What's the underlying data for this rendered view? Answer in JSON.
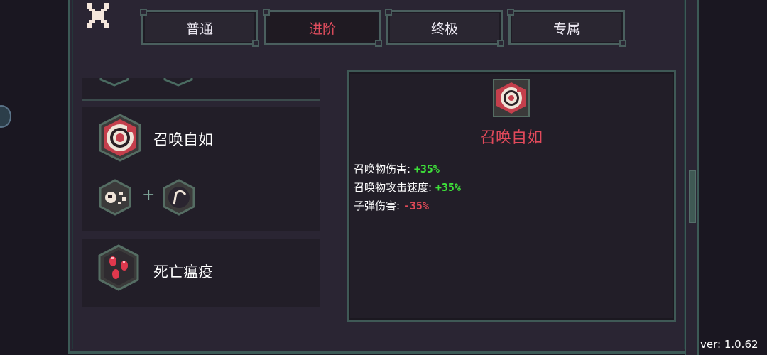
{
  "tabs": [
    {
      "label": "普通",
      "active": false
    },
    {
      "label": "进阶",
      "active": true
    },
    {
      "label": "终极",
      "active": false
    },
    {
      "label": "专属",
      "active": false
    }
  ],
  "skill_list": [
    {
      "name": "召唤自如",
      "icon": "summon-swirl-icon",
      "components": [
        "fragment-burst-icon",
        "scythe-arc-icon"
      ],
      "combine_symbol": "+"
    },
    {
      "name": "死亡瘟疫",
      "icon": "plague-droplets-icon"
    }
  ],
  "detail": {
    "name": "召唤自如",
    "icon": "summon-swirl-icon",
    "stats": [
      {
        "label": "召唤物伤害: ",
        "value": "+35%"
      },
      {
        "label": "召唤物攻击速度: ",
        "value": "+35%"
      },
      {
        "label": "子弹伤害: ",
        "value": "-35%"
      }
    ]
  },
  "version": "ver: 1.0.62",
  "colors": {
    "accent": "#e34a5b",
    "positive": "#3ee13a",
    "negative": "#e24a58",
    "frame": "#3f5956"
  }
}
